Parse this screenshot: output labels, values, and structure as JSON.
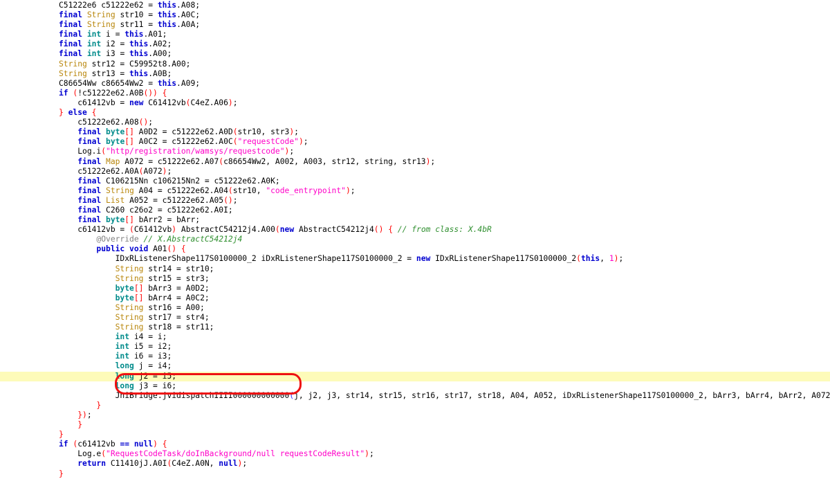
{
  "viewer": {
    "title": "decompiled-java-code-view",
    "background_color": "#ffffff",
    "highlight_color": "#fdfbb9",
    "annotation_color": "#ee1111"
  },
  "colors": {
    "keyword": "#0000d0",
    "type_ref": "#b8860b",
    "type_primitive": "#008b8b",
    "string_literal": "#ff00c8",
    "punctuation": "#ff0000",
    "comment": "#2f8f2f",
    "annotation": "#808080",
    "plain": "#000000",
    "caret": "#3030ff"
  },
  "annotation": {
    "shape": "rounded-rectangle",
    "target_text": "JniBridge.jvidispatchIIII000000000000",
    "color": "#ee1111"
  },
  "code": {
    "language": "java",
    "highlighted_line_index": 38,
    "lines": [
      {
        "indent": 0,
        "tokens": [
          {
            "c": "n",
            "v": "C51222e6 c51222e62 = "
          },
          {
            "c": "k",
            "v": "this"
          },
          {
            "c": "n",
            "v": ".A08;"
          }
        ]
      },
      {
        "indent": 0,
        "tokens": [
          {
            "c": "k",
            "v": "final"
          },
          {
            "c": "n",
            "v": " "
          },
          {
            "c": "t",
            "v": "String"
          },
          {
            "c": "n",
            "v": " str10 = "
          },
          {
            "c": "k",
            "v": "this"
          },
          {
            "c": "n",
            "v": ".A0C;"
          }
        ]
      },
      {
        "indent": 0,
        "tokens": [
          {
            "c": "k",
            "v": "final"
          },
          {
            "c": "n",
            "v": " "
          },
          {
            "c": "t",
            "v": "String"
          },
          {
            "c": "n",
            "v": " str11 = "
          },
          {
            "c": "k",
            "v": "this"
          },
          {
            "c": "n",
            "v": ".A0A;"
          }
        ]
      },
      {
        "indent": 0,
        "tokens": [
          {
            "c": "k",
            "v": "final"
          },
          {
            "c": "n",
            "v": " "
          },
          {
            "c": "p",
            "v": "int"
          },
          {
            "c": "n",
            "v": " i = "
          },
          {
            "c": "k",
            "v": "this"
          },
          {
            "c": "n",
            "v": ".A01;"
          }
        ]
      },
      {
        "indent": 0,
        "tokens": [
          {
            "c": "k",
            "v": "final"
          },
          {
            "c": "n",
            "v": " "
          },
          {
            "c": "p",
            "v": "int"
          },
          {
            "c": "n",
            "v": " i2 = "
          },
          {
            "c": "k",
            "v": "this"
          },
          {
            "c": "n",
            "v": ".A02;"
          }
        ]
      },
      {
        "indent": 0,
        "tokens": [
          {
            "c": "k",
            "v": "final"
          },
          {
            "c": "n",
            "v": " "
          },
          {
            "c": "p",
            "v": "int"
          },
          {
            "c": "n",
            "v": " i3 = "
          },
          {
            "c": "k",
            "v": "this"
          },
          {
            "c": "n",
            "v": ".A00;"
          }
        ]
      },
      {
        "indent": 0,
        "tokens": [
          {
            "c": "t",
            "v": "String"
          },
          {
            "c": "n",
            "v": " str12 = C59952t8.A00;"
          }
        ]
      },
      {
        "indent": 0,
        "tokens": [
          {
            "c": "t",
            "v": "String"
          },
          {
            "c": "n",
            "v": " str13 = "
          },
          {
            "c": "k",
            "v": "this"
          },
          {
            "c": "n",
            "v": ".A0B;"
          }
        ]
      },
      {
        "indent": 0,
        "tokens": [
          {
            "c": "n",
            "v": "C86654Ww c86654Ww2 = "
          },
          {
            "c": "k",
            "v": "this"
          },
          {
            "c": "n",
            "v": ".A09;"
          }
        ]
      },
      {
        "indent": 0,
        "tokens": [
          {
            "c": "k",
            "v": "if"
          },
          {
            "c": "n",
            "v": " "
          },
          {
            "c": "par",
            "v": "("
          },
          {
            "c": "n",
            "v": "!c51222e62.A0B"
          },
          {
            "c": "par",
            "v": "()) {"
          }
        ]
      },
      {
        "indent": 1,
        "tokens": [
          {
            "c": "n",
            "v": "c61412vb = "
          },
          {
            "c": "k",
            "v": "new"
          },
          {
            "c": "n",
            "v": " C61412vb"
          },
          {
            "c": "par",
            "v": "("
          },
          {
            "c": "n",
            "v": "C4eZ.A06"
          },
          {
            "c": "par",
            "v": ")"
          },
          {
            "c": "n",
            "v": ";"
          }
        ]
      },
      {
        "indent": 0,
        "tokens": [
          {
            "c": "par",
            "v": "}"
          },
          {
            "c": "n",
            "v": " "
          },
          {
            "c": "k",
            "v": "else"
          },
          {
            "c": "n",
            "v": " "
          },
          {
            "c": "par",
            "v": "{"
          }
        ]
      },
      {
        "indent": 1,
        "tokens": [
          {
            "c": "n",
            "v": "c51222e62.A08"
          },
          {
            "c": "par",
            "v": "()"
          },
          {
            "c": "n",
            "v": ";"
          }
        ]
      },
      {
        "indent": 1,
        "tokens": [
          {
            "c": "k",
            "v": "final"
          },
          {
            "c": "n",
            "v": " "
          },
          {
            "c": "p",
            "v": "byte"
          },
          {
            "c": "par",
            "v": "[]"
          },
          {
            "c": "n",
            "v": " A0D2 = c51222e62.A0D"
          },
          {
            "c": "par",
            "v": "("
          },
          {
            "c": "n",
            "v": "str10, str3"
          },
          {
            "c": "par",
            "v": ")"
          },
          {
            "c": "n",
            "v": ";"
          }
        ]
      },
      {
        "indent": 1,
        "tokens": [
          {
            "c": "k",
            "v": "final"
          },
          {
            "c": "n",
            "v": " "
          },
          {
            "c": "p",
            "v": "byte"
          },
          {
            "c": "par",
            "v": "[]"
          },
          {
            "c": "n",
            "v": " A0C2 = c51222e62.A0C"
          },
          {
            "c": "par",
            "v": "("
          },
          {
            "c": "s",
            "v": "\"requestCode\""
          },
          {
            "c": "par",
            "v": ")"
          },
          {
            "c": "n",
            "v": ";"
          }
        ]
      },
      {
        "indent": 1,
        "tokens": [
          {
            "c": "n",
            "v": "Log.i"
          },
          {
            "c": "par",
            "v": "("
          },
          {
            "c": "s",
            "v": "\"http/registration/wamsys/requestcode\""
          },
          {
            "c": "par",
            "v": ")"
          },
          {
            "c": "n",
            "v": ";"
          }
        ]
      },
      {
        "indent": 1,
        "tokens": [
          {
            "c": "k",
            "v": "final"
          },
          {
            "c": "n",
            "v": " "
          },
          {
            "c": "t",
            "v": "Map"
          },
          {
            "c": "n",
            "v": " A072 = c51222e62.A07"
          },
          {
            "c": "par",
            "v": "("
          },
          {
            "c": "n",
            "v": "c86654Ww2, A002, A003, str12, string, str13"
          },
          {
            "c": "par",
            "v": ")"
          },
          {
            "c": "n",
            "v": ";"
          }
        ]
      },
      {
        "indent": 1,
        "tokens": [
          {
            "c": "n",
            "v": "c51222e62.A0A"
          },
          {
            "c": "par",
            "v": "("
          },
          {
            "c": "n",
            "v": "A072"
          },
          {
            "c": "par",
            "v": ")"
          },
          {
            "c": "n",
            "v": ";"
          }
        ]
      },
      {
        "indent": 1,
        "tokens": [
          {
            "c": "k",
            "v": "final"
          },
          {
            "c": "n",
            "v": " C106215Nn c106215Nn2 = c51222e62.A0K;"
          }
        ]
      },
      {
        "indent": 1,
        "tokens": [
          {
            "c": "k",
            "v": "final"
          },
          {
            "c": "n",
            "v": " "
          },
          {
            "c": "t",
            "v": "String"
          },
          {
            "c": "n",
            "v": " A04 = c51222e62.A04"
          },
          {
            "c": "par",
            "v": "("
          },
          {
            "c": "n",
            "v": "str10, "
          },
          {
            "c": "s",
            "v": "\"code_entrypoint\""
          },
          {
            "c": "par",
            "v": ")"
          },
          {
            "c": "n",
            "v": ";"
          }
        ]
      },
      {
        "indent": 1,
        "tokens": [
          {
            "c": "k",
            "v": "final"
          },
          {
            "c": "n",
            "v": " "
          },
          {
            "c": "t",
            "v": "List"
          },
          {
            "c": "n",
            "v": " A052 = c51222e62.A05"
          },
          {
            "c": "par",
            "v": "()"
          },
          {
            "c": "n",
            "v": ";"
          }
        ]
      },
      {
        "indent": 1,
        "tokens": [
          {
            "c": "k",
            "v": "final"
          },
          {
            "c": "n",
            "v": " C260 c26o2 = c51222e62.A0I;"
          }
        ]
      },
      {
        "indent": 1,
        "tokens": [
          {
            "c": "k",
            "v": "final"
          },
          {
            "c": "n",
            "v": " "
          },
          {
            "c": "p",
            "v": "byte"
          },
          {
            "c": "par",
            "v": "[]"
          },
          {
            "c": "n",
            "v": " bArr2 = bArr;"
          }
        ]
      },
      {
        "indent": 1,
        "tokens": [
          {
            "c": "n",
            "v": "c61412vb = "
          },
          {
            "c": "par",
            "v": "("
          },
          {
            "c": "n",
            "v": "C61412vb"
          },
          {
            "c": "par",
            "v": ")"
          },
          {
            "c": "n",
            "v": " AbstractC54212j4.A00"
          },
          {
            "c": "par",
            "v": "("
          },
          {
            "c": "k",
            "v": "new"
          },
          {
            "c": "n",
            "v": " AbstractC54212j4"
          },
          {
            "c": "par",
            "v": "()"
          },
          {
            "c": "n",
            "v": " "
          },
          {
            "c": "par",
            "v": "{"
          },
          {
            "c": "n",
            "v": " "
          },
          {
            "c": "cm",
            "v": "// from class: X.4bR"
          }
        ]
      },
      {
        "indent": 2,
        "tokens": [
          {
            "c": "an",
            "v": "@Override"
          },
          {
            "c": "n",
            "v": " "
          },
          {
            "c": "cm",
            "v": "// X.AbstractC54212j4"
          }
        ]
      },
      {
        "indent": 2,
        "tokens": [
          {
            "c": "k",
            "v": "public"
          },
          {
            "c": "n",
            "v": " "
          },
          {
            "c": "k",
            "v": "void"
          },
          {
            "c": "n",
            "v": " A01"
          },
          {
            "c": "par",
            "v": "()"
          },
          {
            "c": "n",
            "v": " "
          },
          {
            "c": "par",
            "v": "{"
          }
        ]
      },
      {
        "indent": 3,
        "tokens": [
          {
            "c": "n",
            "v": "IDxRListenerShape117S0100000_2 iDxRListenerShape117S0100000_2 = "
          },
          {
            "c": "k",
            "v": "new"
          },
          {
            "c": "n",
            "v": " IDxRListenerShape117S0100000_2"
          },
          {
            "c": "par",
            "v": "("
          },
          {
            "c": "k",
            "v": "this"
          },
          {
            "c": "n",
            "v": ", "
          },
          {
            "c": "num",
            "v": "1"
          },
          {
            "c": "par",
            "v": ")"
          },
          {
            "c": "n",
            "v": ";"
          }
        ]
      },
      {
        "indent": 3,
        "tokens": [
          {
            "c": "t",
            "v": "String"
          },
          {
            "c": "n",
            "v": " str14 = str10;"
          }
        ]
      },
      {
        "indent": 3,
        "tokens": [
          {
            "c": "t",
            "v": "String"
          },
          {
            "c": "n",
            "v": " str15 = str3;"
          }
        ]
      },
      {
        "indent": 3,
        "tokens": [
          {
            "c": "p",
            "v": "byte"
          },
          {
            "c": "par",
            "v": "[]"
          },
          {
            "c": "n",
            "v": " bArr3 = A0D2;"
          }
        ]
      },
      {
        "indent": 3,
        "tokens": [
          {
            "c": "p",
            "v": "byte"
          },
          {
            "c": "par",
            "v": "[]"
          },
          {
            "c": "n",
            "v": " bArr4 = A0C2;"
          }
        ]
      },
      {
        "indent": 3,
        "tokens": [
          {
            "c": "t",
            "v": "String"
          },
          {
            "c": "n",
            "v": " str16 = A00;"
          }
        ]
      },
      {
        "indent": 3,
        "tokens": [
          {
            "c": "t",
            "v": "String"
          },
          {
            "c": "n",
            "v": " str17 = str4;"
          }
        ]
      },
      {
        "indent": 3,
        "tokens": [
          {
            "c": "t",
            "v": "String"
          },
          {
            "c": "n",
            "v": " str18 = str11;"
          }
        ]
      },
      {
        "indent": 3,
        "tokens": [
          {
            "c": "p",
            "v": "int"
          },
          {
            "c": "n",
            "v": " i4 = i;"
          }
        ]
      },
      {
        "indent": 3,
        "tokens": [
          {
            "c": "p",
            "v": "int"
          },
          {
            "c": "n",
            "v": " i5 = i2;"
          }
        ]
      },
      {
        "indent": 3,
        "tokens": [
          {
            "c": "p",
            "v": "int"
          },
          {
            "c": "n",
            "v": " i6 = i3;"
          }
        ]
      },
      {
        "indent": 3,
        "tokens": [
          {
            "c": "p",
            "v": "long"
          },
          {
            "c": "n",
            "v": " j = i4;"
          }
        ]
      },
      {
        "indent": 3,
        "tokens": [
          {
            "c": "p",
            "v": "long"
          },
          {
            "c": "n",
            "v": " j2 = i5;"
          }
        ]
      },
      {
        "indent": 3,
        "tokens": [
          {
            "c": "p",
            "v": "long"
          },
          {
            "c": "n",
            "v": " j3 = i6;"
          }
        ]
      },
      {
        "indent": 3,
        "tokens": [
          {
            "c": "n",
            "v": "JniBridge.jvidispatchIIII000000000000"
          },
          {
            "c": "cur",
            "v": "("
          },
          {
            "c": "n",
            "v": "j, j2, j3, str14, str15, str16, str17, str18, A04, A052, iDxRListenerShape117S0100000_2, bArr3, bArr4, bArr2, A072"
          },
          {
            "c": "cur",
            "v": ")"
          },
          {
            "c": "n",
            "v": ";"
          }
        ]
      },
      {
        "indent": 2,
        "tokens": [
          {
            "c": "par",
            "v": "}"
          }
        ]
      },
      {
        "indent": 1,
        "tokens": [
          {
            "c": "par",
            "v": "})"
          },
          {
            "c": "n",
            "v": ";"
          }
        ]
      },
      {
        "indent": 1,
        "tokens": [
          {
            "c": "par",
            "v": "}"
          }
        ]
      },
      {
        "indent": 0,
        "tokens": [
          {
            "c": "par",
            "v": "}"
          }
        ]
      },
      {
        "indent": 0,
        "tokens": [
          {
            "c": "k",
            "v": "if"
          },
          {
            "c": "n",
            "v": " "
          },
          {
            "c": "par",
            "v": "("
          },
          {
            "c": "n",
            "v": "c61412vb "
          },
          {
            "c": "k",
            "v": "=="
          },
          {
            "c": "n",
            "v": " "
          },
          {
            "c": "k",
            "v": "null"
          },
          {
            "c": "par",
            "v": ") {"
          }
        ]
      },
      {
        "indent": 1,
        "tokens": [
          {
            "c": "n",
            "v": "Log.e"
          },
          {
            "c": "par",
            "v": "("
          },
          {
            "c": "s",
            "v": "\"RequestCodeTask/doInBackground/null requestCodeResult\""
          },
          {
            "c": "par",
            "v": ")"
          },
          {
            "c": "n",
            "v": ";"
          }
        ]
      },
      {
        "indent": 1,
        "tokens": [
          {
            "c": "k",
            "v": "return"
          },
          {
            "c": "n",
            "v": " C11410jJ.A0I"
          },
          {
            "c": "par",
            "v": "("
          },
          {
            "c": "n",
            "v": "C4eZ.A0N, "
          },
          {
            "c": "k",
            "v": "null"
          },
          {
            "c": "par",
            "v": ")"
          },
          {
            "c": "n",
            "v": ";"
          }
        ]
      },
      {
        "indent": 0,
        "tokens": [
          {
            "c": "par",
            "v": "}"
          }
        ]
      }
    ]
  }
}
